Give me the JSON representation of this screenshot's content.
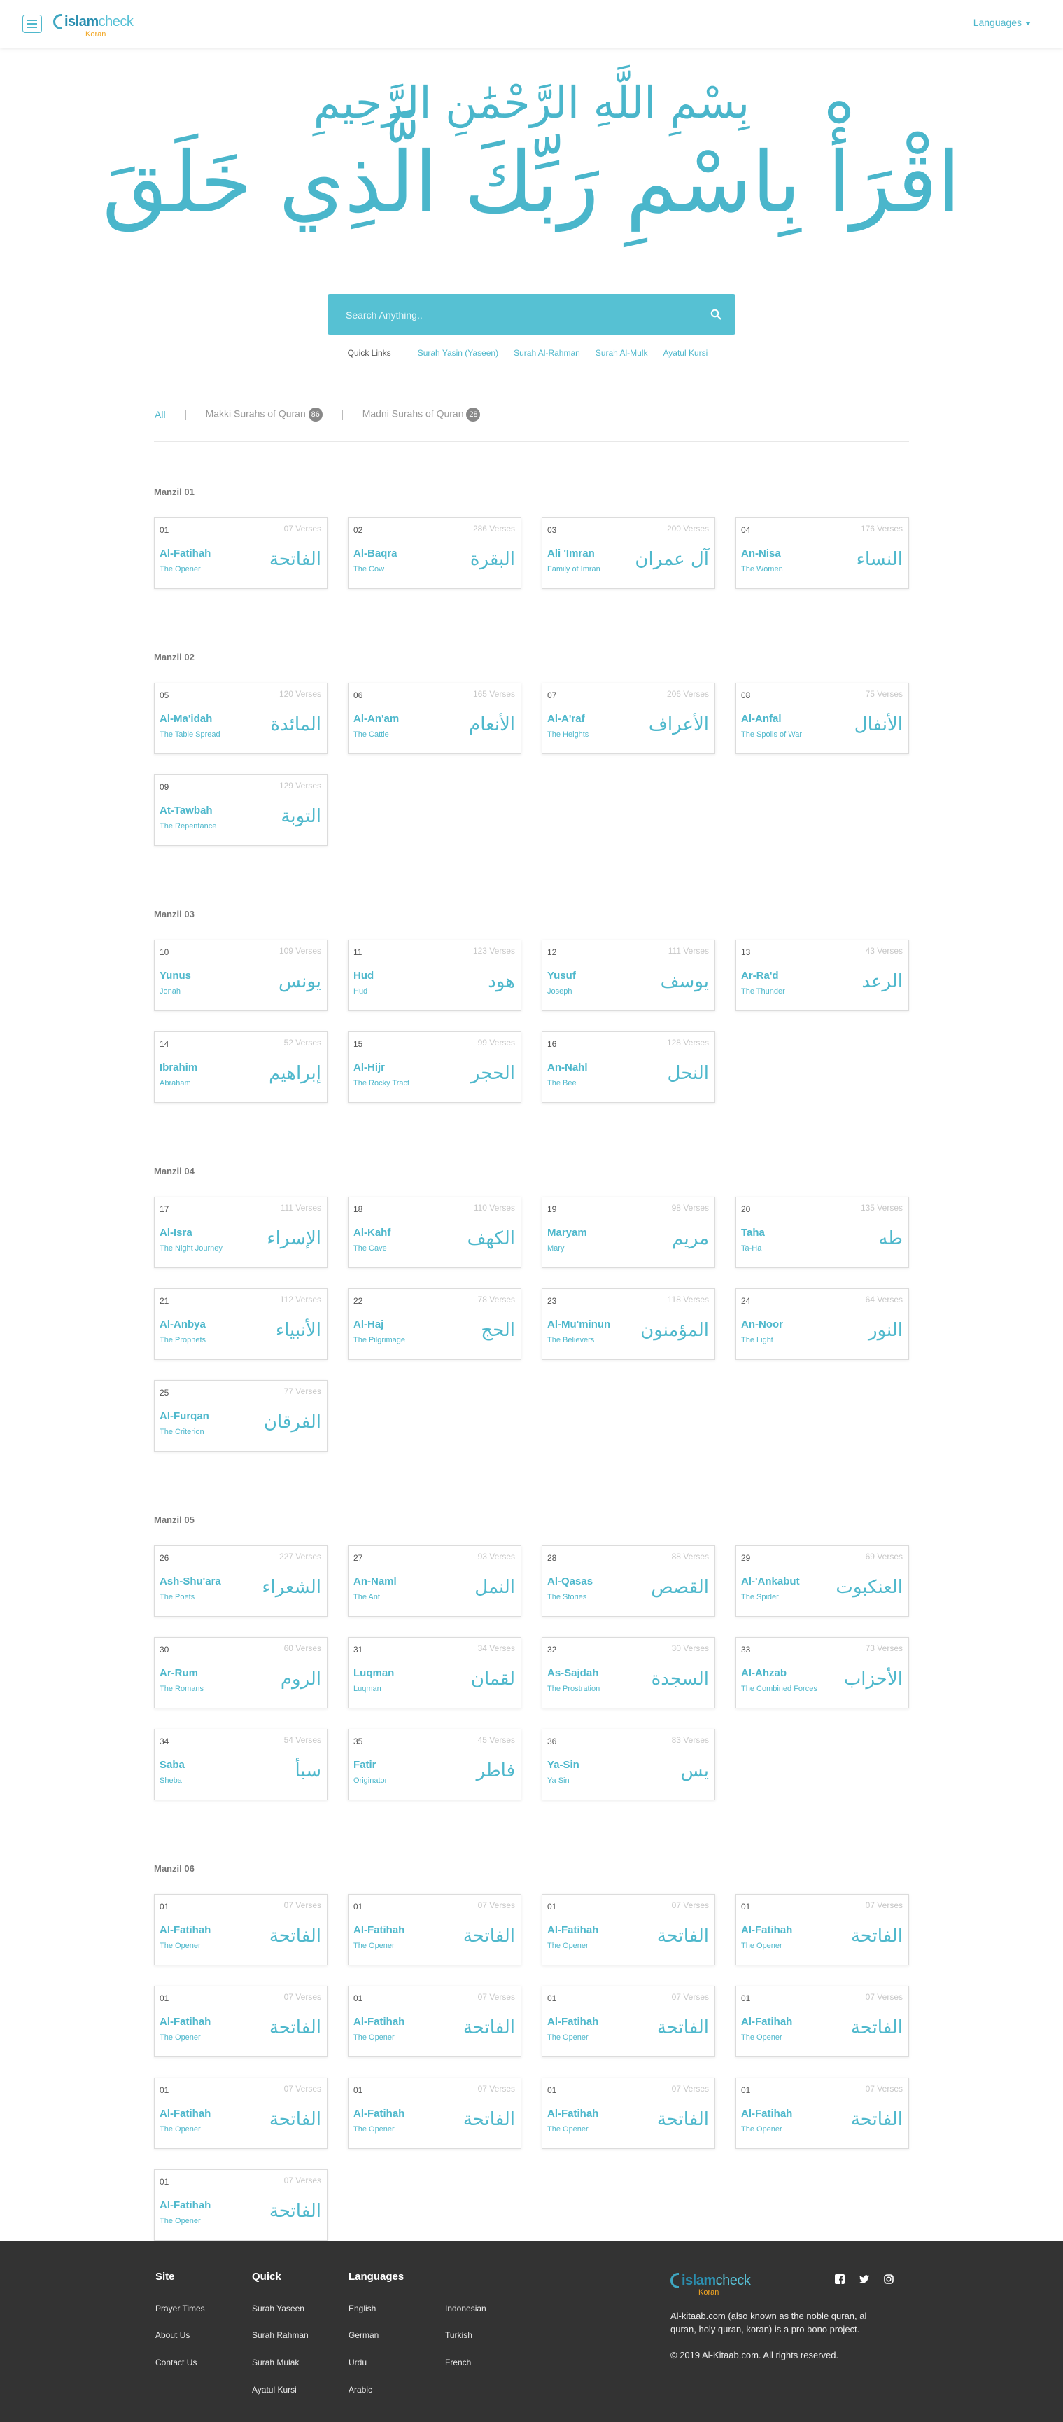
{
  "header": {
    "logo_main_a": "islam",
    "logo_main_b": "check",
    "logo_sub": "Koran",
    "languages_label": "Languages"
  },
  "hero": {
    "bismillah": "بِسْمِ اللَّهِ الرَّحْمَٰنِ الرَّحِيمِ",
    "iqra": "اقْرَأْ بِاسْمِ رَبِّكَ الَّذِي خَلَقَ"
  },
  "search": {
    "placeholder": "Search Anything.."
  },
  "quick_links": {
    "label": "Quick Links",
    "links": [
      "Surah Yasin (Yaseen)",
      "Surah Al-Rahman",
      "Surah Al-Mulk",
      "Ayatul Kursi"
    ]
  },
  "filters": {
    "all": "All",
    "makki": "Makki Surahs of Quran",
    "makki_count": "86",
    "madni": "Madni Surahs of Quran",
    "madni_count": "28"
  },
  "manzils": [
    {
      "title": "Manzil 01",
      "surahs": [
        {
          "num": "01",
          "verses": "07 Verses",
          "name": "Al-Fatihah",
          "trans": "The Opener",
          "arabic": "الفاتحة"
        },
        {
          "num": "02",
          "verses": "286 Verses",
          "name": "Al-Baqra",
          "trans": "The Cow",
          "arabic": "البقرة"
        },
        {
          "num": "03",
          "verses": "200 Verses",
          "name": "Ali 'Imran",
          "trans": "Family of Imran",
          "arabic": "آل عمران"
        },
        {
          "num": "04",
          "verses": "176 Verses",
          "name": "An-Nisa",
          "trans": "The Women",
          "arabic": "النساء"
        }
      ]
    },
    {
      "title": "Manzil 02",
      "surahs": [
        {
          "num": "05",
          "verses": "120 Verses",
          "name": "Al-Ma'idah",
          "trans": "The Table Spread",
          "arabic": "المائدة"
        },
        {
          "num": "06",
          "verses": "165 Verses",
          "name": "Al-An'am",
          "trans": "The Cattle",
          "arabic": "الأنعام"
        },
        {
          "num": "07",
          "verses": "206 Verses",
          "name": "Al-A'raf",
          "trans": "The Heights",
          "arabic": "الأعراف"
        },
        {
          "num": "08",
          "verses": "75 Verses",
          "name": "Al-Anfal",
          "trans": "The Spoils of War",
          "arabic": "الأنفال"
        },
        {
          "num": "09",
          "verses": "129 Verses",
          "name": "At-Tawbah",
          "trans": "The Repentance",
          "arabic": "التوبة"
        }
      ]
    },
    {
      "title": "Manzil 03",
      "surahs": [
        {
          "num": "10",
          "verses": "109 Verses",
          "name": "Yunus",
          "trans": "Jonah",
          "arabic": "يونس"
        },
        {
          "num": "11",
          "verses": "123 Verses",
          "name": "Hud",
          "trans": "Hud",
          "arabic": "هود"
        },
        {
          "num": "12",
          "verses": "111 Verses",
          "name": "Yusuf",
          "trans": "Joseph",
          "arabic": "يوسف"
        },
        {
          "num": "13",
          "verses": "43 Verses",
          "name": "Ar-Ra'd",
          "trans": "The Thunder",
          "arabic": "الرعد"
        },
        {
          "num": "14",
          "verses": "52 Verses",
          "name": "Ibrahim",
          "trans": "Abraham",
          "arabic": "إبراهيم"
        },
        {
          "num": "15",
          "verses": "99 Verses",
          "name": "Al-Hijr",
          "trans": "The Rocky Tract",
          "arabic": "الحجر"
        },
        {
          "num": "16",
          "verses": "128 Verses",
          "name": "An-Nahl",
          "trans": "The Bee",
          "arabic": "النحل"
        }
      ]
    },
    {
      "title": "Manzil 04",
      "surahs": [
        {
          "num": "17",
          "verses": "111 Verses",
          "name": "Al-Isra",
          "trans": "The Night Journey",
          "arabic": "الإسراء"
        },
        {
          "num": "18",
          "verses": "110 Verses",
          "name": "Al-Kahf",
          "trans": "The Cave",
          "arabic": "الكهف"
        },
        {
          "num": "19",
          "verses": "98 Verses",
          "name": "Maryam",
          "trans": "Mary",
          "arabic": "مريم"
        },
        {
          "num": "20",
          "verses": "135 Verses",
          "name": "Taha",
          "trans": "Ta-Ha",
          "arabic": "طه"
        },
        {
          "num": "21",
          "verses": "112 Verses",
          "name": "Al-Anbya",
          "trans": "The Prophets",
          "arabic": "الأنبياء"
        },
        {
          "num": "22",
          "verses": "78 Verses",
          "name": "Al-Haj",
          "trans": "The Pilgrimage",
          "arabic": "الحج"
        },
        {
          "num": "23",
          "verses": "118 Verses",
          "name": "Al-Mu'minun",
          "trans": "The Believers",
          "arabic": "المؤمنون"
        },
        {
          "num": "24",
          "verses": "64 Verses",
          "name": "An-Noor",
          "trans": "The Light",
          "arabic": "النور"
        },
        {
          "num": "25",
          "verses": "77 Verses",
          "name": "Al-Furqan",
          "trans": "The Criterion",
          "arabic": "الفرقان"
        }
      ]
    },
    {
      "title": "Manzil 05",
      "surahs": [
        {
          "num": "26",
          "verses": "227 Verses",
          "name": "Ash-Shu'ara",
          "trans": "The Poets",
          "arabic": "الشعراء"
        },
        {
          "num": "27",
          "verses": "93 Verses",
          "name": "An-Naml",
          "trans": "The Ant",
          "arabic": "النمل"
        },
        {
          "num": "28",
          "verses": "88 Verses",
          "name": "Al-Qasas",
          "trans": "The Stories",
          "arabic": "القصص"
        },
        {
          "num": "29",
          "verses": "69 Verses",
          "name": "Al-'Ankabut",
          "trans": "The Spider",
          "arabic": "العنكبوت"
        },
        {
          "num": "30",
          "verses": "60 Verses",
          "name": "Ar-Rum",
          "trans": "The Romans",
          "arabic": "الروم"
        },
        {
          "num": "31",
          "verses": "34 Verses",
          "name": "Luqman",
          "trans": "Luqman",
          "arabic": "لقمان"
        },
        {
          "num": "32",
          "verses": "30 Verses",
          "name": "As-Sajdah",
          "trans": "The Prostration",
          "arabic": "السجدة"
        },
        {
          "num": "33",
          "verses": "73 Verses",
          "name": "Al-Ahzab",
          "trans": "The Combined Forces",
          "arabic": "الأحزاب"
        },
        {
          "num": "34",
          "verses": "54 Verses",
          "name": "Saba",
          "trans": "Sheba",
          "arabic": "سبأ"
        },
        {
          "num": "35",
          "verses": "45 Verses",
          "name": "Fatir",
          "trans": "Originator",
          "arabic": "فاطر"
        },
        {
          "num": "36",
          "verses": "83 Verses",
          "name": "Ya-Sin",
          "trans": "Ya Sin",
          "arabic": "يس"
        }
      ]
    },
    {
      "title": "Manzil 06",
      "surahs": [
        {
          "num": "01",
          "verses": "07 Verses",
          "name": "Al-Fatihah",
          "trans": "The Opener",
          "arabic": "الفاتحة"
        },
        {
          "num": "01",
          "verses": "07 Verses",
          "name": "Al-Fatihah",
          "trans": "The Opener",
          "arabic": "الفاتحة"
        },
        {
          "num": "01",
          "verses": "07 Verses",
          "name": "Al-Fatihah",
          "trans": "The Opener",
          "arabic": "الفاتحة"
        },
        {
          "num": "01",
          "verses": "07 Verses",
          "name": "Al-Fatihah",
          "trans": "The Opener",
          "arabic": "الفاتحة"
        },
        {
          "num": "01",
          "verses": "07 Verses",
          "name": "Al-Fatihah",
          "trans": "The Opener",
          "arabic": "الفاتحة"
        },
        {
          "num": "01",
          "verses": "07 Verses",
          "name": "Al-Fatihah",
          "trans": "The Opener",
          "arabic": "الفاتحة"
        },
        {
          "num": "01",
          "verses": "07 Verses",
          "name": "Al-Fatihah",
          "trans": "The Opener",
          "arabic": "الفاتحة"
        },
        {
          "num": "01",
          "verses": "07 Verses",
          "name": "Al-Fatihah",
          "trans": "The Opener",
          "arabic": "الفاتحة"
        },
        {
          "num": "01",
          "verses": "07 Verses",
          "name": "Al-Fatihah",
          "trans": "The Opener",
          "arabic": "الفاتحة"
        },
        {
          "num": "01",
          "verses": "07 Verses",
          "name": "Al-Fatihah",
          "trans": "The Opener",
          "arabic": "الفاتحة"
        },
        {
          "num": "01",
          "verses": "07 Verses",
          "name": "Al-Fatihah",
          "trans": "The Opener",
          "arabic": "الفاتحة"
        },
        {
          "num": "01",
          "verses": "07 Verses",
          "name": "Al-Fatihah",
          "trans": "The Opener",
          "arabic": "الفاتحة"
        },
        {
          "num": "01",
          "verses": "07 Verses",
          "name": "Al-Fatihah",
          "trans": "The Opener",
          "arabic": "الفاتحة"
        }
      ]
    }
  ],
  "footer": {
    "site_title": "Site",
    "site_links": [
      "Prayer Times",
      "About Us",
      "Contact Us"
    ],
    "quick_title": "Quick",
    "quick_links": [
      "Surah Yaseen",
      "Surah Rahman",
      "Surah Mulak",
      "Ayatul Kursi"
    ],
    "languages_title": "Languages",
    "languages_col1": [
      "English",
      "German",
      "Urdu",
      "Arabic"
    ],
    "languages_col2": [
      "Indonesian",
      "Turkish",
      "French"
    ],
    "logo_main_a": "islam",
    "logo_main_b": "check",
    "logo_sub": "Koran",
    "about": "Al-kitaab.com (also known as the noble quran, al quran, holy quran, koran) is a pro bono project.",
    "copyright": "© 2019 Al-Kitaab.com. All rights reserved.",
    "social_icons": [
      "facebook-icon",
      "twitter-icon",
      "instagram-icon"
    ]
  },
  "colors": {
    "accent": "#4fb8cc",
    "search_bg": "#56c1d3",
    "footer_bg": "#333333",
    "logo_sub": "#f2a623"
  }
}
